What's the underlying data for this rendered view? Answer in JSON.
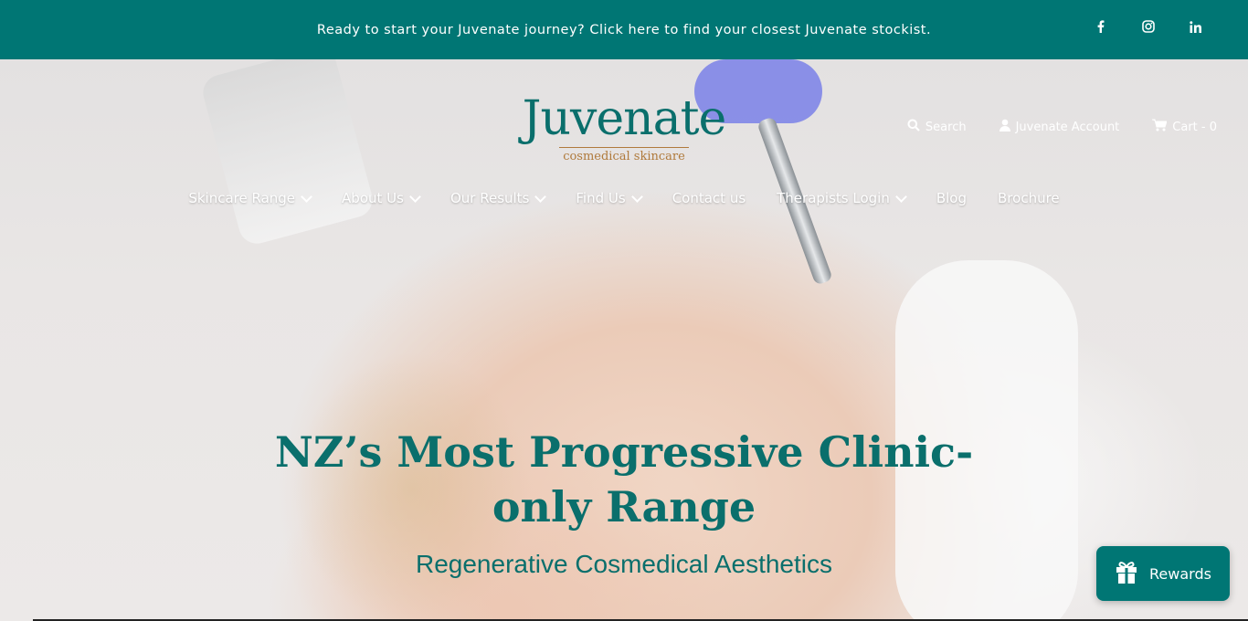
{
  "announcement": {
    "text": "Ready to start your Juvenate journey? Click here to find your closest Juvenate stockist."
  },
  "social": [
    "facebook-icon",
    "instagram-icon",
    "linkedin-icon"
  ],
  "logo": {
    "title": "Juvenate",
    "subtitle": "cosmedical skincare"
  },
  "utility": {
    "search": "Search",
    "account": "Juvenate Account",
    "cart": "Cart - 0"
  },
  "nav": {
    "items": [
      {
        "label": "Skincare Range"
      },
      {
        "label": "About Us"
      },
      {
        "label": "Our Results"
      },
      {
        "label": "Find Us"
      },
      {
        "label": "Contact us"
      },
      {
        "label": "Therapists Login"
      },
      {
        "label": "Blog"
      },
      {
        "label": "Brochure"
      }
    ]
  },
  "hero": {
    "headline_line1": "NZ’s Most Progressive Clinic-",
    "headline_line2": "only Range",
    "subheadline": "Regenerative Cosmedical Aesthetics"
  },
  "rewards": {
    "label": "Rewards"
  },
  "colors": {
    "brand": "#007674",
    "brand_text": "#0a6f6c",
    "gold": "#b07a3c"
  }
}
